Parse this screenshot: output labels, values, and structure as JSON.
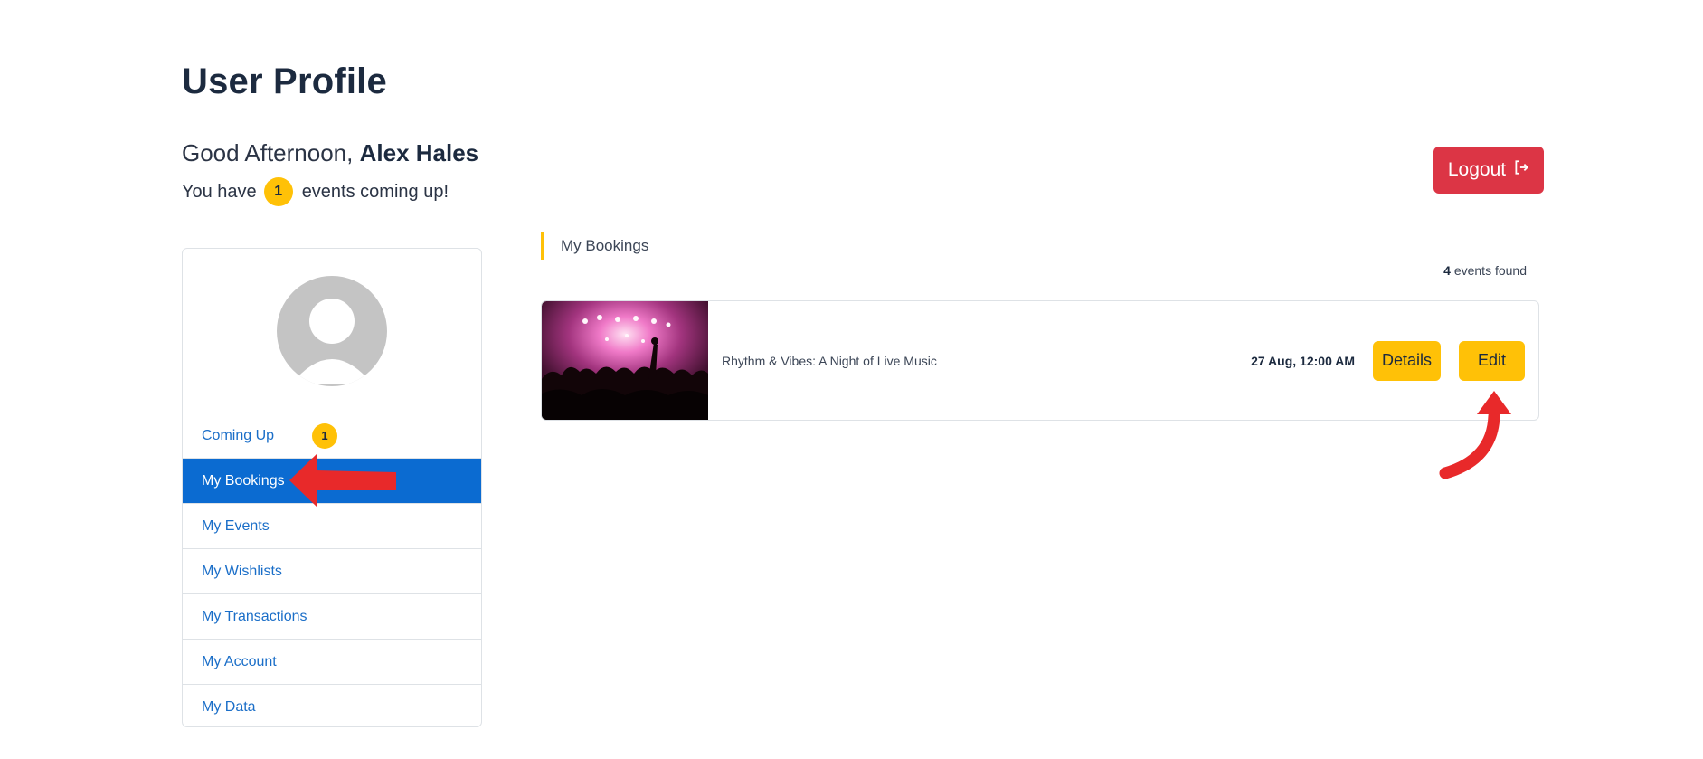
{
  "page": {
    "title": "User Profile"
  },
  "greeting": {
    "prefix": "Good Afternoon,",
    "name": "Alex Hales"
  },
  "upcoming": {
    "prefix": "You have",
    "count": "1",
    "suffix": "events coming up!"
  },
  "logout": {
    "label": "Logout",
    "icon": "logout-icon"
  },
  "sidebar": {
    "avatar_icon": "user-avatar-icon",
    "items": [
      {
        "label": "Coming Up",
        "badge": "1"
      },
      {
        "label": "My Bookings",
        "active": true
      },
      {
        "label": "My Events"
      },
      {
        "label": "My Wishlists"
      },
      {
        "label": "My Transactions"
      },
      {
        "label": "My Account"
      },
      {
        "label": "My Data"
      }
    ]
  },
  "main": {
    "section_title": "My Bookings",
    "found_count": "4",
    "found_suffix": "events found",
    "bookings": [
      {
        "title": "Rhythm & Vibes: A Night of Live Music",
        "date": "27 Aug, 12:00 AM",
        "details_label": "Details",
        "edit_label": "Edit"
      }
    ]
  },
  "colors": {
    "accent": "#ffc107",
    "primary": "#0b6bd1",
    "danger": "#dc3545",
    "annotation": "#e8292a"
  }
}
